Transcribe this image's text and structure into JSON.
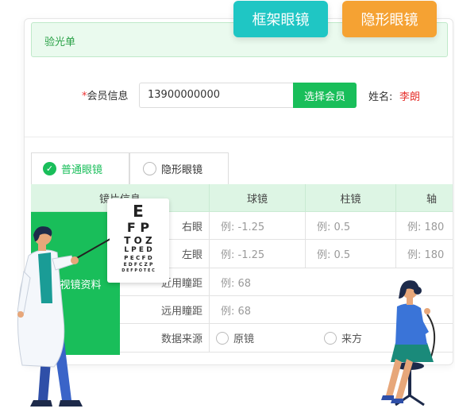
{
  "pills": {
    "frame": "框架眼镜",
    "contact": "隐形眼镜"
  },
  "form": {
    "title": "验光单",
    "member_label": "会员信息",
    "member_required": "*",
    "member_value": "13900000000",
    "select_member_button": "选择会员",
    "name_label": "姓名:",
    "name_value": "李朗"
  },
  "tabs": [
    {
      "label": "普通眼镜",
      "active": true
    },
    {
      "label": "隐形眼镜",
      "active": false
    }
  ],
  "table": {
    "headers": [
      "镜片信息",
      "球镜",
      "柱镜",
      "轴"
    ],
    "side_label": "近视镜资料",
    "rows": [
      {
        "label": "右眼",
        "sphere": "例: -1.25",
        "cylinder": "例: 0.5",
        "axis": "例: 180"
      },
      {
        "label": "左眼",
        "sphere": "例: -1.25",
        "cylinder": "例: 0.5",
        "axis": "例: 180"
      },
      {
        "label": "近用瞳距",
        "value": "例: 68"
      },
      {
        "label": "远用瞳距",
        "value": "例: 68"
      },
      {
        "label": "数据来源",
        "options": [
          "原镜",
          "来方"
        ]
      }
    ]
  },
  "eye_chart": [
    "E",
    "F P",
    "T O Z",
    "L P E D",
    "P E C F D",
    "E D F C Z P",
    "D E F P O T E C"
  ],
  "colors": {
    "green": "#19be5a",
    "teal": "#1fc6c4",
    "orange": "#f5a233",
    "red": "#e5322d"
  }
}
